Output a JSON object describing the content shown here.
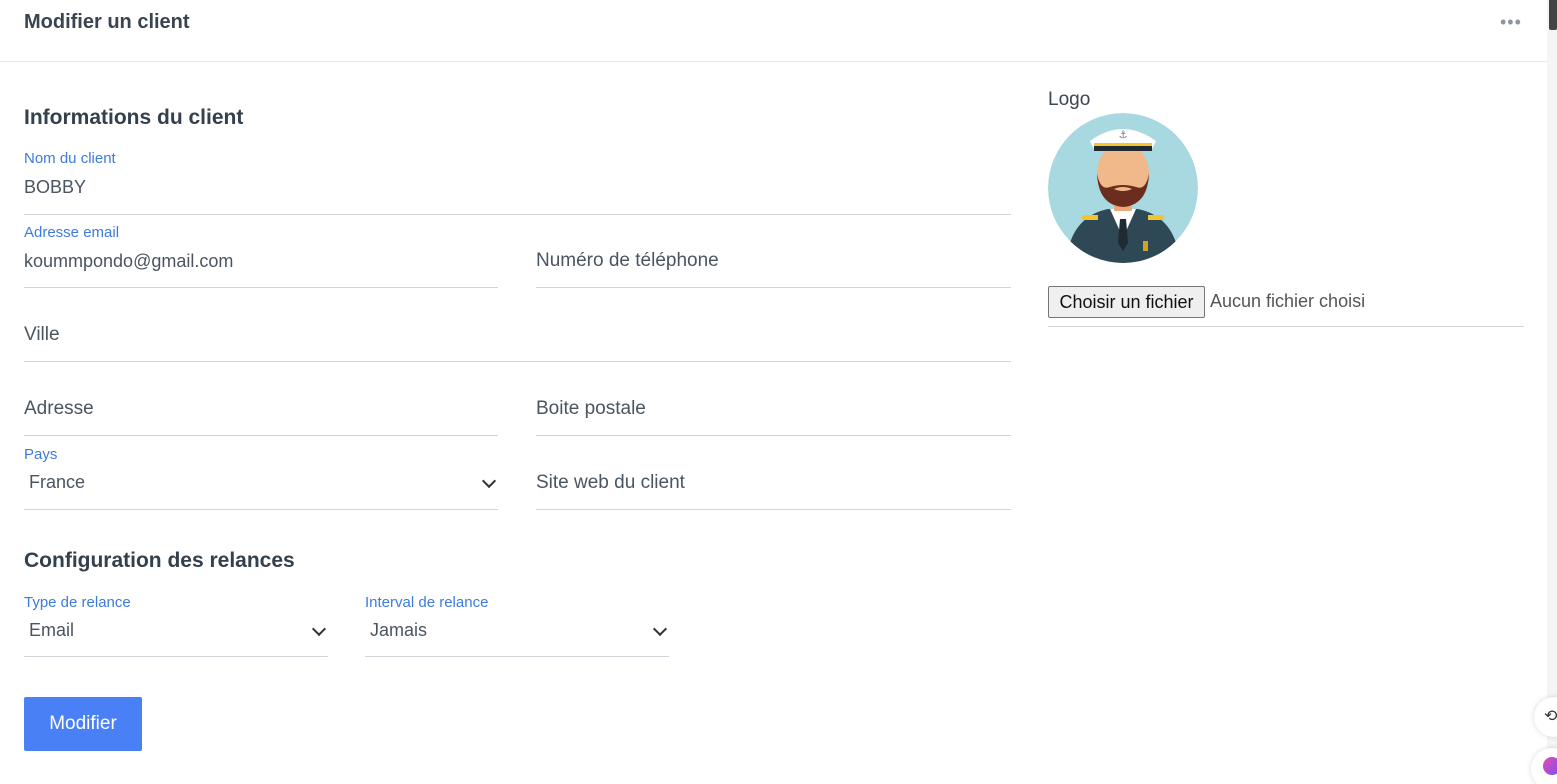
{
  "header": {
    "title": "Modifier un client",
    "more_icon": "•••"
  },
  "client_section": {
    "title": "Informations du client",
    "name": {
      "label": "Nom du client",
      "value": "BOBBY"
    },
    "email": {
      "label": "Adresse email",
      "value": "koummpondo@gmail.com"
    },
    "phone": {
      "placeholder": "Numéro de téléphone"
    },
    "city": {
      "placeholder": "Ville"
    },
    "address": {
      "placeholder": "Adresse"
    },
    "postal_box": {
      "placeholder": "Boite postale"
    },
    "country": {
      "label": "Pays",
      "value": "France"
    },
    "website": {
      "placeholder": "Site web du client"
    }
  },
  "reminder_section": {
    "title": "Configuration des relances",
    "type": {
      "label": "Type de relance",
      "value": "Email"
    },
    "interval": {
      "label": "Interval de relance",
      "value": "Jamais"
    }
  },
  "logo": {
    "label": "Logo",
    "avatar": "captain-avatar",
    "file_button": "Choisir un fichier",
    "file_status": "Aucun fichier choisi"
  },
  "actions": {
    "submit_label": "Modifier"
  },
  "colors": {
    "accent": "#4a80f5",
    "label_blue": "#3d7bdc",
    "avatar_bg": "#a8d8e0"
  }
}
